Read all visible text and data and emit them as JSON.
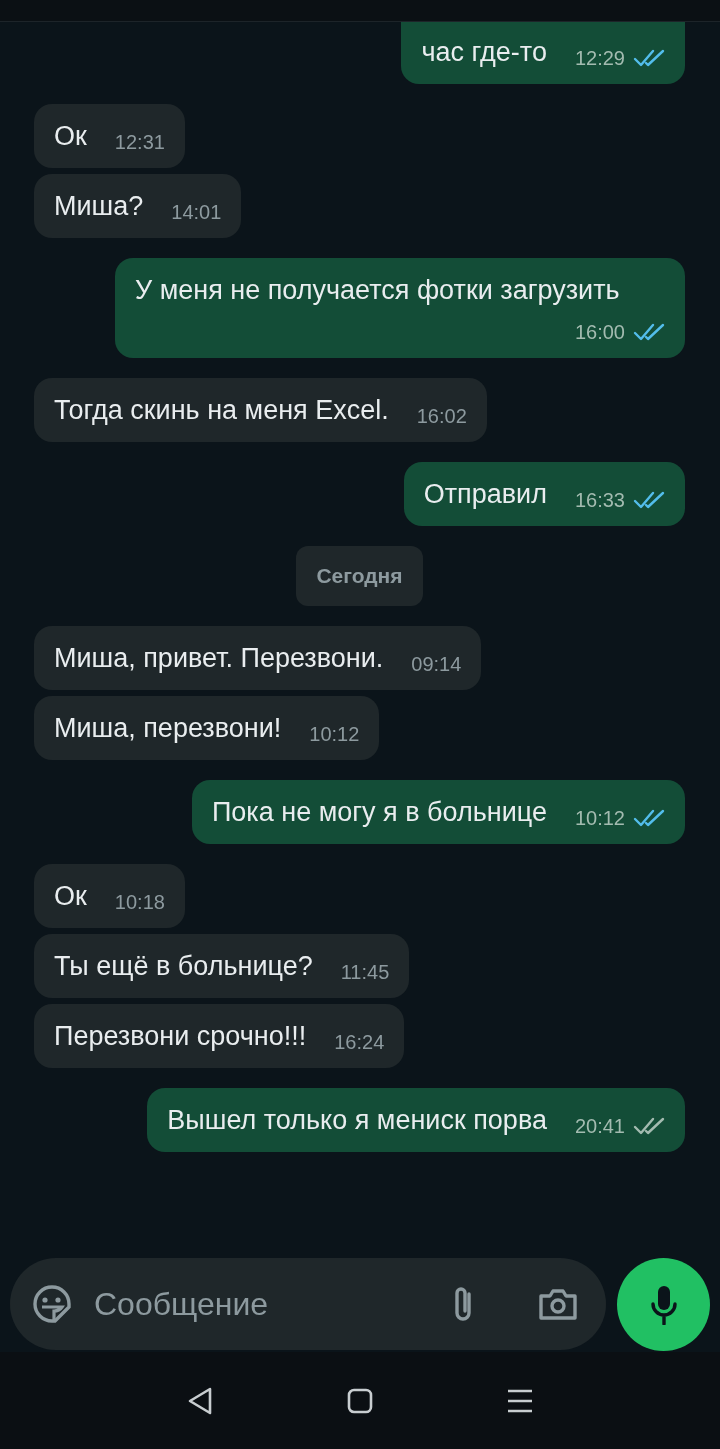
{
  "messages": [
    {
      "kind": "out",
      "text": "час где-то",
      "time": "12:29",
      "read": true
    },
    {
      "kind": "in",
      "text": "Ок",
      "time": "12:31"
    },
    {
      "kind": "in",
      "text": "Миша?",
      "time": "14:01"
    },
    {
      "kind": "out",
      "text": "У меня не получается фотки загрузить",
      "time": "16:00",
      "read": true
    },
    {
      "kind": "in",
      "text": "Тогда скинь на меня Excel.",
      "time": "16:02"
    },
    {
      "kind": "out",
      "text": "Отправил",
      "time": "16:33",
      "read": true
    },
    {
      "kind": "date",
      "text": "Сегодня"
    },
    {
      "kind": "in",
      "text": "Миша, привет. Перезвони.",
      "time": "09:14"
    },
    {
      "kind": "in",
      "text": "Миша, перезвони!",
      "time": "10:12"
    },
    {
      "kind": "out",
      "text": "Пока не могу я в больнице",
      "time": "10:12",
      "read": true
    },
    {
      "kind": "in",
      "text": "Ок",
      "time": "10:18"
    },
    {
      "kind": "in",
      "text": "Ты ещё в больнице?",
      "time": "11:45"
    },
    {
      "kind": "in",
      "text": "Перезвони срочно!!!",
      "time": "16:24"
    },
    {
      "kind": "out",
      "text": "Вышел только я мениск порва",
      "time": "20:41",
      "read": false
    }
  ],
  "composer": {
    "placeholder": "Сообщение"
  }
}
